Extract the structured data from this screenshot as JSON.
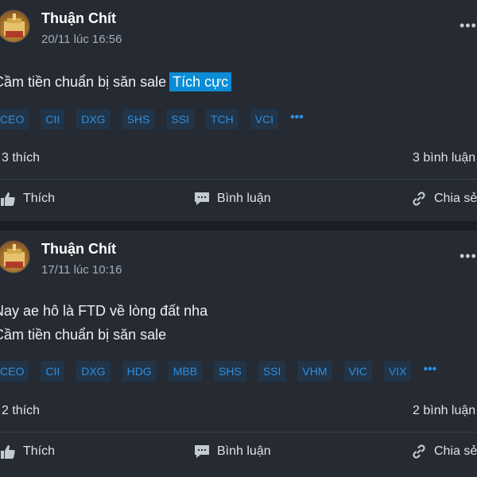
{
  "posts": [
    {
      "author": "Thuận Chít",
      "timestamp": "20/11 lúc 16:56",
      "content_lines": [
        "Cầm tiền chuẩn bị săn sale"
      ],
      "sentiment_tag": "Tích cực",
      "tickers": [
        "CEO",
        "CII",
        "DXG",
        "SHS",
        "SSI",
        "TCH",
        "VCI"
      ],
      "more_tickers": "•••",
      "likes": "3 thích",
      "comments": "3 bình luận",
      "actions": {
        "like": "Thích",
        "comment": "Bình luận",
        "share": "Chia sẻ"
      },
      "more_menu": "•••"
    },
    {
      "author": "Thuận Chít",
      "timestamp": "17/11 lúc 10:16",
      "content_lines": [
        "Nay ae hô là FTD về lòng đất nha",
        "Cầm tiền chuẩn bị săn sale"
      ],
      "tickers": [
        "CEO",
        "CII",
        "DXG",
        "HDG",
        "MBB",
        "SHS",
        "SSI",
        "VHM",
        "VIC",
        "VIX"
      ],
      "more_tickers": "•••",
      "likes": "2 thích",
      "comments": "2 bình luận",
      "actions": {
        "like": "Thích",
        "comment": "Bình luận",
        "share": "Chia sẻ"
      },
      "more_menu": "•••"
    }
  ],
  "colors": {
    "background": "#1a1d23",
    "card": "#252a33",
    "accent": "#0a8dd6",
    "ticker_text": "#2e8fe0"
  },
  "icons": [
    "more-horizontal-icon",
    "thumbs-up-icon",
    "comment-icon",
    "share-link-icon"
  ]
}
